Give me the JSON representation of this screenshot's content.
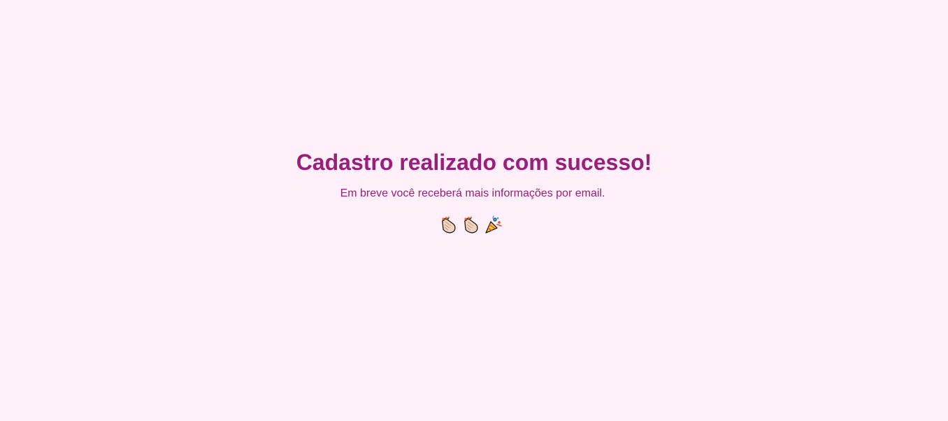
{
  "success": {
    "title": "Cadastro realizado com sucesso!",
    "subtitle": "Em breve você receberá mais informações por email."
  },
  "celebration": {
    "icons": [
      "clapping-hands-icon",
      "clapping-hands-icon",
      "party-popper-icon"
    ]
  },
  "colors": {
    "background": "#fff0fa",
    "accent": "#98207c"
  }
}
